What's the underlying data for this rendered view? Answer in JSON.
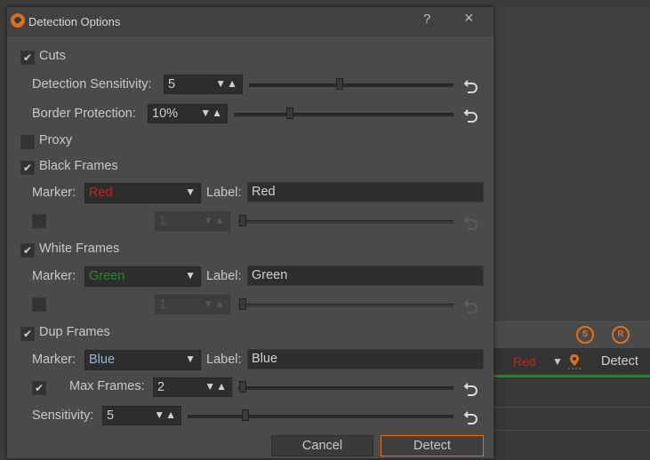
{
  "dialog": {
    "title": "Detection Options",
    "help_label": "?",
    "close_label": "×"
  },
  "cuts": {
    "label": "Cuts",
    "checked": true,
    "sensitivity_label": "Detection Sensitivity:",
    "sensitivity_value": "5",
    "border_label": "Border Protection:",
    "border_value": "10%"
  },
  "proxy": {
    "label": "Proxy",
    "checked": false
  },
  "black_frames": {
    "label": "Black Frames",
    "checked": true,
    "marker_label": "Marker:",
    "marker_value": "Red",
    "marker_color": "#c0261e",
    "label_label": "Label:",
    "label_value": "Red",
    "threshold_value": "1"
  },
  "white_frames": {
    "label": "White Frames",
    "checked": true,
    "marker_label": "Marker:",
    "marker_value": "Green",
    "marker_color": "#2c8a2c",
    "label_label": "Label:",
    "label_value": "Green",
    "threshold_value": "1"
  },
  "dup_frames": {
    "label": "Dup Frames",
    "checked": true,
    "marker_label": "Marker:",
    "marker_value": "Blue",
    "marker_color": "#8fb4e0",
    "label_label": "Label:",
    "label_value": "Blue",
    "max_frames_label": "Max Frames:",
    "max_frames_value": "2",
    "sensitivity_label": "Sensitivity:",
    "sensitivity_value": "5"
  },
  "buttons": {
    "cancel": "Cancel",
    "detect": "Detect"
  },
  "background_panel": {
    "marker_value": "Red",
    "marker_color": "#c0261e",
    "detect_label": "Detect",
    "icon_s": "S",
    "icon_r": "R"
  },
  "glyphs": {
    "check": "✔",
    "arrows": "▼▲",
    "dropdown": "▼"
  }
}
